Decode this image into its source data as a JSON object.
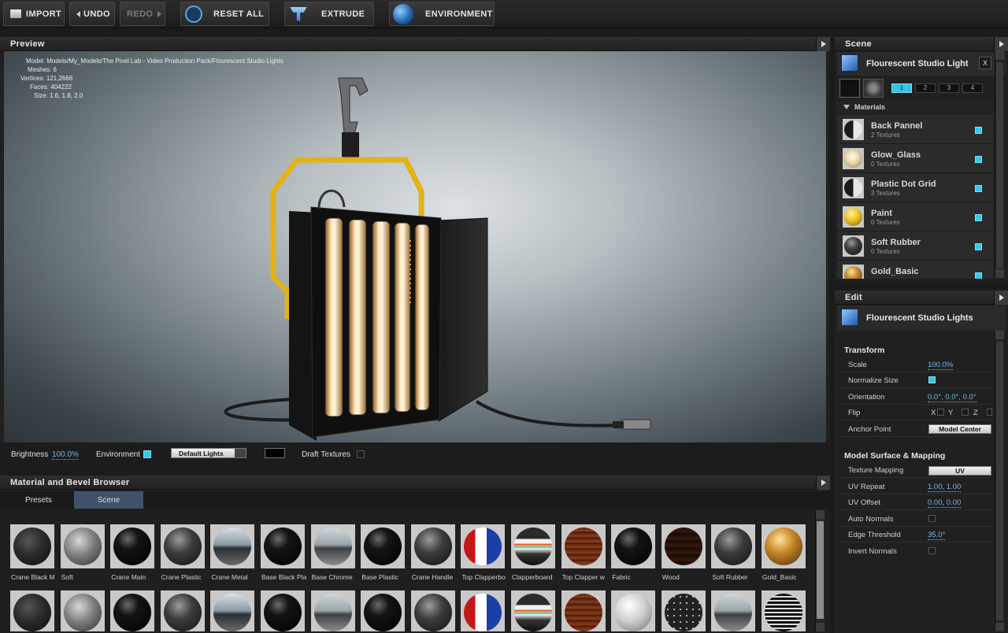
{
  "toolbar": {
    "import": "IMPORT",
    "undo": "UNDO",
    "redo": "REDO",
    "reset_all": "RESET ALL",
    "extrude": "EXTRUDE",
    "environment": "ENVIRONMENT"
  },
  "preview": {
    "title": "Preview",
    "info": {
      "model": "Model: Models/My_Models/The Pixel Lab - Video Production Pack/Flourescent Studio Lights",
      "meshes": "Meshes: 6",
      "vertices": "Vertices: 121,2666",
      "faces": "Faces: 404222",
      "size": "Size: 1.6, 1.8, 2.0"
    },
    "bar": {
      "brightness_label": "Brightness",
      "brightness_value": "100.0%",
      "environment_label": "Environment",
      "environment_checked": true,
      "lights_select": "Default Lights",
      "draft_label": "Draft Textures",
      "draft_checked": false
    }
  },
  "browser": {
    "title": "Material and Bevel Browser",
    "tabs": [
      "Presets",
      "Scene"
    ],
    "active_tab": "Scene",
    "row1": [
      {
        "label": "Crane Black M",
        "style": "dark-matte"
      },
      {
        "label": "Soft",
        "style": "grey"
      },
      {
        "label": "Crane Main",
        "style": "black-gloss"
      },
      {
        "label": "Crane Plastic",
        "style": "dark-grey"
      },
      {
        "label": "Crane Metal",
        "style": "chrome-dark"
      },
      {
        "label": "Base Black Pla",
        "style": "black-gloss"
      },
      {
        "label": "Base Chrome",
        "style": "chrome"
      },
      {
        "label": "Base Plastic",
        "style": "black-gloss"
      },
      {
        "label": "Crane Handle",
        "style": "dark-grey"
      },
      {
        "label": "Top Clapperbo",
        "style": "flag"
      },
      {
        "label": "Clapperboard",
        "style": "stripes"
      },
      {
        "label": "Top Clapper w",
        "style": "wood"
      },
      {
        "label": "Fabric",
        "style": "black-gloss"
      },
      {
        "label": "Wood",
        "style": "dark-wood"
      },
      {
        "label": "Soft Rubber",
        "style": "dark-grey"
      },
      {
        "label": "Gold_Basic",
        "style": "gold"
      }
    ],
    "row2": [
      "dark-matte",
      "grey",
      "black-gloss",
      "dark-grey",
      "chrome-dark",
      "black-gloss",
      "chrome",
      "black-gloss",
      "dark-grey",
      "flag",
      "stripes",
      "wood",
      "white",
      "dots",
      "chrome",
      "grid"
    ]
  },
  "scene": {
    "title": "Scene",
    "object_name": "Flourescent Studio Light",
    "close_label": "X",
    "tabs": [
      "1",
      "2",
      "3",
      "4"
    ],
    "materials_header": "Materials",
    "materials": [
      {
        "name": "Back Pannel",
        "sub": "2 Textures",
        "style": "halfdark"
      },
      {
        "name": "Glow_Glass",
        "sub": "0 Textures",
        "style": "glow"
      },
      {
        "name": "Plastic Dot Grid",
        "sub": "3 Textures",
        "style": "halfdark"
      },
      {
        "name": "Paint",
        "sub": "0 Textures",
        "style": "yellow"
      },
      {
        "name": "Soft Rubber",
        "sub": "0 Textures",
        "style": "dark-grey"
      },
      {
        "name": "Gold_Basic",
        "sub": "",
        "style": "gold"
      }
    ]
  },
  "edit": {
    "title": "Edit",
    "object_name": "Flourescent Studio Lights",
    "transform_header": "Transform",
    "scale_label": "Scale",
    "scale_value": "100.0%",
    "normalize_label": "Normalize Size",
    "orientation_label": "Orientation",
    "orientation_value": "0.0°, 0.0°, 0.0°",
    "flip_label": "Flip",
    "flip_x": "X",
    "flip_y": "Y",
    "flip_z": "Z",
    "anchor_label": "Anchor Point",
    "anchor_value": "Model Center",
    "surface_header": "Model Surface & Mapping",
    "texture_mapping_label": "Texture Mapping",
    "texture_mapping_value": "UV",
    "uv_repeat_label": "UV Repeat",
    "uv_repeat_value": "1.00, 1.00",
    "uv_offset_label": "UV Offset",
    "uv_offset_value": "0.00, 0.00",
    "auto_normals_label": "Auto Normals",
    "edge_threshold_label": "Edge Threshold",
    "edge_threshold_value": "35.0°",
    "invert_normals_label": "Invert Normals"
  }
}
